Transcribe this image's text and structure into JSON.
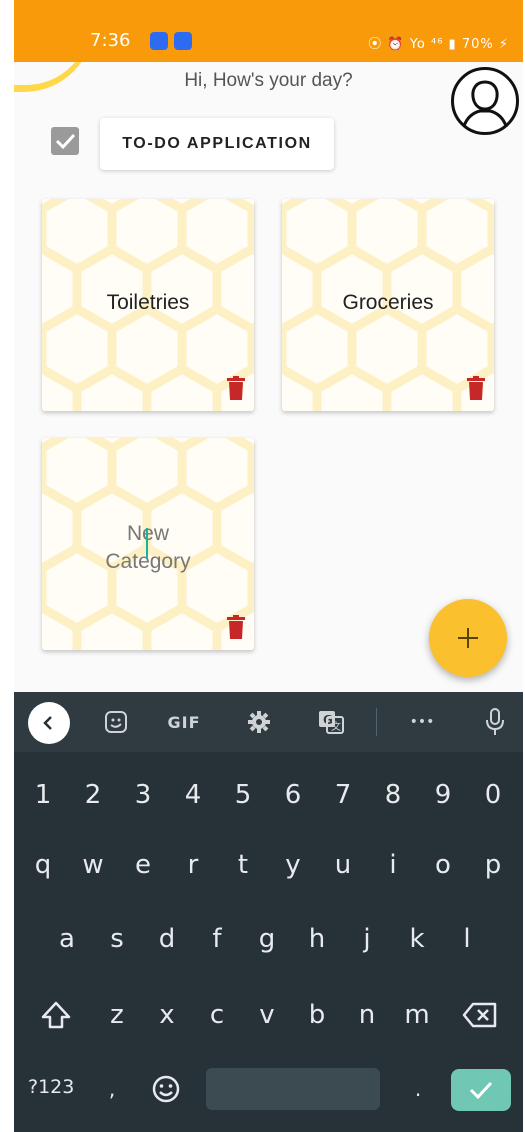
{
  "status_bar": {
    "time": "7:36",
    "indicators": "⦿ ⏰ Yo ⁴⁶ ▮ 70% ⚡",
    "battery": "70%"
  },
  "header": {
    "greeting": "Hi, How's your day?"
  },
  "app": {
    "title": "TO-DO APPLICATION"
  },
  "categories": [
    {
      "label": "Toiletries"
    },
    {
      "label": "Groceries"
    },
    {
      "label": "New Category"
    }
  ],
  "fab": {
    "label": "+"
  },
  "keyboard": {
    "toolbar": {
      "gif": "GIF",
      "more": "•••"
    },
    "numbers": [
      "1",
      "2",
      "3",
      "4",
      "5",
      "6",
      "7",
      "8",
      "9",
      "0"
    ],
    "row1": [
      "q",
      "w",
      "e",
      "r",
      "t",
      "y",
      "u",
      "i",
      "o",
      "p"
    ],
    "row2": [
      "a",
      "s",
      "d",
      "f",
      "g",
      "h",
      "j",
      "k",
      "l"
    ],
    "row3": [
      "z",
      "x",
      "c",
      "v",
      "b",
      "n",
      "m"
    ],
    "symbols": "?123",
    "comma": ",",
    "period": "."
  },
  "colors": {
    "status_bar": "#f89a0a",
    "fab": "#fbc02d",
    "trash": "#c62828",
    "keyboard_bg": "#263238",
    "enter_key": "#6fc7b4"
  }
}
